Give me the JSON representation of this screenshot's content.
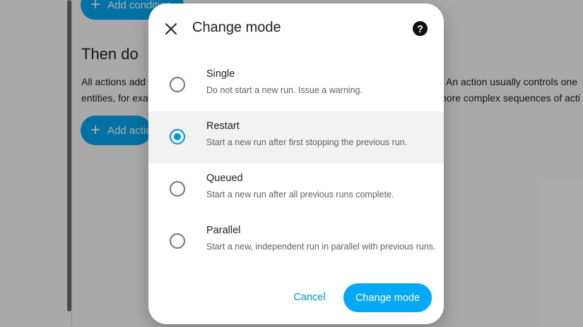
{
  "background": {
    "add_condition_label": "Add condition",
    "then_do_heading": "Then do",
    "description_line1": "All actions add",
    "description_line2": "entities, for exa",
    "description_right1": "An action usually controls one",
    "description_right2": "nore complex sequences of acti",
    "add_action_label": "Add actio"
  },
  "dialog": {
    "title": "Change mode",
    "close_icon": "close-icon",
    "help_icon": "help-circle-icon",
    "options": [
      {
        "label": "Single",
        "description": "Do not start a new run. Issue a warning.",
        "selected": false
      },
      {
        "label": "Restart",
        "description": "Start a new run after first stopping the previous run.",
        "selected": true
      },
      {
        "label": "Queued",
        "description": "Start a new run after all previous runs complete.",
        "selected": false
      },
      {
        "label": "Parallel",
        "description": "Start a new, independent run in parallel with previous runs.",
        "selected": false
      }
    ],
    "cancel_label": "Cancel",
    "confirm_label": "Change mode"
  },
  "colors": {
    "accent": "#03a9f4",
    "radio_selected": "#0096d6",
    "selected_row": "#f2f2f2"
  }
}
